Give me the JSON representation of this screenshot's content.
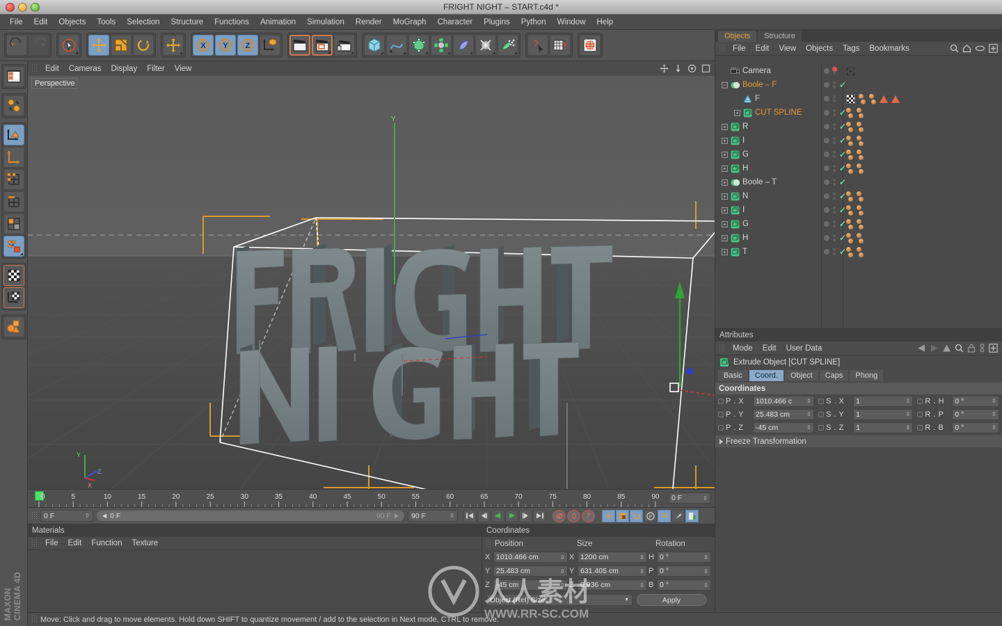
{
  "window": {
    "title": "FRIGHT NIGHT – START.c4d *"
  },
  "menubar": {
    "items": [
      "File",
      "Edit",
      "Objects",
      "Tools",
      "Selection",
      "Structure",
      "Functions",
      "Animation",
      "Simulation",
      "Render",
      "MoGraph",
      "Character",
      "Plugins",
      "Python",
      "Window",
      "Help"
    ]
  },
  "toolbar": {
    "groups": [
      {
        "buttons": [
          {
            "name": "undo-button",
            "icon": "undo",
            "state": "normal"
          },
          {
            "name": "redo-button",
            "icon": "redo",
            "state": "disabled"
          }
        ]
      },
      {
        "buttons": [
          {
            "name": "live-selection-button",
            "icon": "live-selection",
            "state": "normal",
            "corner": true
          }
        ]
      },
      {
        "buttons": [
          {
            "name": "move-tool-button",
            "icon": "move",
            "state": "selected"
          },
          {
            "name": "scale-tool-button",
            "icon": "scale",
            "state": "normal"
          },
          {
            "name": "rotate-tool-button",
            "icon": "rotate",
            "state": "normal"
          }
        ]
      },
      {
        "buttons": [
          {
            "name": "move-alt-button",
            "icon": "move",
            "state": "normal",
            "corner": true
          }
        ]
      },
      {
        "buttons": [
          {
            "name": "axis-x-button",
            "icon": "axis-x",
            "state": "selected"
          },
          {
            "name": "axis-y-button",
            "icon": "axis-y",
            "state": "selected"
          },
          {
            "name": "axis-z-button",
            "icon": "axis-z",
            "state": "selected"
          },
          {
            "name": "world-object-axis-button",
            "icon": "world-axis",
            "state": "normal"
          }
        ]
      },
      {
        "buttons": [
          {
            "name": "render-view-button",
            "icon": "render-view",
            "state": "highlight"
          },
          {
            "name": "render-region-button",
            "icon": "render-region",
            "state": "highlight-small",
            "corner": true
          },
          {
            "name": "render-settings-button",
            "icon": "render-settings",
            "state": "normal",
            "corner": true
          }
        ]
      },
      {
        "buttons": [
          {
            "name": "primitive-cube-button",
            "icon": "cube",
            "state": "normal",
            "corner": true
          },
          {
            "name": "spline-pen-button",
            "icon": "spline",
            "state": "normal",
            "corner": true
          },
          {
            "name": "generator-nurbs-button",
            "icon": "nurbs",
            "state": "normal",
            "corner": true
          },
          {
            "name": "modeling-object-button",
            "icon": "deformer-green",
            "state": "normal",
            "corner": true
          },
          {
            "name": "deformer-button",
            "icon": "bend",
            "state": "normal",
            "corner": true
          },
          {
            "name": "environment-button",
            "icon": "light",
            "state": "normal",
            "corner": true
          },
          {
            "name": "camera-button",
            "icon": "particles",
            "state": "normal",
            "corner": true
          }
        ]
      },
      {
        "buttons": [
          {
            "name": "help-cursor-button",
            "icon": "help-cursor",
            "state": "normal"
          },
          {
            "name": "help-table-button",
            "icon": "help-table",
            "state": "normal"
          }
        ]
      },
      {
        "buttons": [
          {
            "name": "content-browser-button",
            "icon": "globe",
            "state": "normal"
          }
        ]
      }
    ]
  },
  "left_rail": {
    "groups": [
      {
        "buttons": [
          {
            "name": "layout-button",
            "icon": "layout",
            "state": "normal"
          }
        ]
      },
      {
        "buttons": [
          {
            "name": "undo-view-button",
            "icon": "view-nav",
            "state": "normal"
          }
        ]
      },
      {
        "buttons": [
          {
            "name": "object-mode-button",
            "icon": "object-axis",
            "state": "selected"
          },
          {
            "name": "axis-mode-button",
            "icon": "axis",
            "state": "normal"
          },
          {
            "name": "point-mode-button",
            "icon": "points",
            "state": "normal"
          },
          {
            "name": "edge-mode-button",
            "icon": "edges",
            "state": "normal"
          },
          {
            "name": "polygon-mode-button",
            "icon": "polygons",
            "state": "normal"
          },
          {
            "name": "model-mode-button",
            "icon": "model",
            "state": "selected",
            "corner": true
          }
        ]
      },
      {
        "buttons": [
          {
            "name": "texture-mode-button",
            "icon": "texture",
            "state": "highlight"
          },
          {
            "name": "texture-axis-button",
            "icon": "texture-axis",
            "state": "highlight"
          }
        ]
      },
      {
        "buttons": [
          {
            "name": "enable-axis-button",
            "icon": "maxon-objects",
            "state": "normal"
          }
        ]
      }
    ],
    "brand": "MAXON\nCINEMA 4D",
    "brand_line1": "MAXON",
    "brand_line2": "CINEMA 4D"
  },
  "viewport": {
    "menu": [
      "Edit",
      "Cameras",
      "Display",
      "Filter",
      "View"
    ],
    "label": "Perspective",
    "scene_text_line1": "FRIGHT",
    "scene_text_line2": "NIGHT",
    "icons": [
      "move-view-icon",
      "scale-view-icon",
      "rotate-view-icon",
      "maximize-view-icon"
    ],
    "axis_labels": {
      "x": "X",
      "y": "Y",
      "z": "Z"
    }
  },
  "timeline": {
    "ticks": [
      0,
      5,
      10,
      15,
      20,
      25,
      30,
      35,
      40,
      45,
      50,
      55,
      60,
      65,
      70,
      75,
      80,
      85,
      90
    ],
    "current_frame_field": "0 F",
    "start_field": "0 F",
    "scrub_value": "0 F",
    "end_preview": "90 F",
    "end_field": "90 F",
    "transport": [
      "go-to-start",
      "step-back",
      "play-back",
      "play-forward",
      "step-forward",
      "go-to-end"
    ],
    "record_buttons": [
      "record-icon",
      "autokey-icon",
      "keyframe-selection-icon"
    ],
    "key_mode_buttons": [
      "position-key-icon",
      "scale-key-icon",
      "rotation-key-icon",
      "param-key-icon",
      "pla-key-icon",
      "point-level-icon",
      "autokey-toggle-icon"
    ]
  },
  "materials": {
    "title": "Materials",
    "menu": [
      "File",
      "Edit",
      "Function",
      "Texture"
    ]
  },
  "bottom_coordinates": {
    "title": "Coordinates",
    "columns": [
      "Position",
      "Size",
      "Rotation"
    ],
    "rows": [
      {
        "axis": "X",
        "position": "1010.466 cm",
        "size_axis": "X",
        "size": "1200 cm",
        "rot_axis": "H",
        "rotation": "0 °"
      },
      {
        "axis": "Y",
        "position": "25.483 cm",
        "size_axis": "Y",
        "size": "631.405 cm",
        "rot_axis": "P",
        "rotation": "0 °"
      },
      {
        "axis": "Z",
        "position": "-45 cm",
        "size_axis": "Z",
        "size": "0.936 cm",
        "rot_axis": "B",
        "rotation": "0 °"
      }
    ],
    "mode_select": "Object (Rel) Size",
    "apply_label": "Apply"
  },
  "statusbar": {
    "text": "Move: Click and drag to move elements. Hold down SHIFT to quantize movement / add to the selection in Next mode, CTRL to remove."
  },
  "objects_panel": {
    "tabs": [
      {
        "label": "Objects",
        "active": true
      },
      {
        "label": "Structure",
        "active": false
      }
    ],
    "menu": [
      "File",
      "Edit",
      "View",
      "Objects",
      "Tags",
      "Bookmarks"
    ],
    "right_icons": [
      "search-icon",
      "home-icon",
      "eye-icon",
      "plus-icon"
    ],
    "items": [
      {
        "name": "Camera",
        "indent": 0,
        "color": "white",
        "icon": "camera",
        "expander": "none",
        "dot_red": true,
        "check": false,
        "tags": [
          "target-tag"
        ]
      },
      {
        "name": "Boole – F",
        "indent": 0,
        "color": "orange",
        "icon": "boole",
        "expander": "minus",
        "check": true,
        "tags": []
      },
      {
        "name": "F",
        "indent": 1,
        "color": "white",
        "icon": "spline-cone",
        "expander": "none",
        "check": false,
        "tags": [
          "checker-texture",
          "material-dot",
          "material-dot",
          "triangle-red",
          "triangle-red"
        ]
      },
      {
        "name": "CUT SPLINE",
        "indent": 1,
        "color": "orange",
        "icon": "extrude",
        "expander": "plus",
        "check": true,
        "tags": [
          "material-dot",
          "material-dot"
        ]
      },
      {
        "name": "R",
        "indent": 0,
        "color": "white",
        "icon": "extrude",
        "expander": "plus",
        "check": true,
        "tags": [
          "material-dot",
          "material-dot"
        ]
      },
      {
        "name": "I",
        "indent": 0,
        "color": "white",
        "icon": "extrude",
        "expander": "plus",
        "check": true,
        "tags": [
          "material-dot",
          "material-dot"
        ]
      },
      {
        "name": "G",
        "indent": 0,
        "color": "white",
        "icon": "extrude",
        "expander": "plus",
        "check": true,
        "tags": [
          "material-dot",
          "material-dot"
        ]
      },
      {
        "name": "H",
        "indent": 0,
        "color": "white",
        "icon": "extrude",
        "expander": "plus",
        "check": true,
        "tags": [
          "material-dot",
          "material-dot"
        ]
      },
      {
        "name": "Boole – T",
        "indent": 0,
        "color": "white",
        "icon": "boole",
        "expander": "plus",
        "check": true,
        "tags": []
      },
      {
        "name": "N",
        "indent": 0,
        "color": "white",
        "icon": "extrude",
        "expander": "plus",
        "check": true,
        "tags": [
          "material-dot",
          "material-dot"
        ]
      },
      {
        "name": "I",
        "indent": 0,
        "color": "white",
        "icon": "extrude",
        "expander": "plus",
        "check": true,
        "tags": [
          "material-dot",
          "material-dot"
        ]
      },
      {
        "name": "G",
        "indent": 0,
        "color": "white",
        "icon": "extrude",
        "expander": "plus",
        "check": true,
        "tags": [
          "material-dot",
          "material-dot"
        ]
      },
      {
        "name": "H",
        "indent": 0,
        "color": "white",
        "icon": "extrude",
        "expander": "plus",
        "check": true,
        "tags": [
          "material-dot",
          "material-dot"
        ]
      },
      {
        "name": "T",
        "indent": 0,
        "color": "white",
        "icon": "extrude",
        "expander": "plus",
        "check": true,
        "tags": [
          "material-dot",
          "material-dot"
        ]
      }
    ]
  },
  "attributes_panel": {
    "title": "Attributes",
    "menu": [
      "Mode",
      "Edit",
      "User Data"
    ],
    "right_icons": [
      "back-arrow-icon",
      "forward-arrow-icon",
      "up-arrow-icon",
      "search-icon",
      "lock-icon",
      "link-icon",
      "plus-icon"
    ],
    "object_label": "Extrude Object [CUT SPLINE]",
    "tabs": [
      {
        "label": "Basic",
        "active": false
      },
      {
        "label": "Coord.",
        "active": true
      },
      {
        "label": "Object",
        "active": false
      },
      {
        "label": "Caps",
        "active": false
      },
      {
        "label": "Phong",
        "active": false
      }
    ],
    "section_title": "Coordinates",
    "rows": [
      {
        "pos_label": "P . X",
        "pos_value": "1010.466 c",
        "scale_label": "S . X",
        "scale_value": "1",
        "rot_label": "R . H",
        "rot_value": "0 °"
      },
      {
        "pos_label": "P . Y",
        "pos_value": "25.483 cm",
        "scale_label": "S . Y",
        "scale_value": "1",
        "rot_label": "R . P",
        "rot_value": "0 °"
      },
      {
        "pos_label": "P . Z",
        "pos_value": "-45 cm",
        "scale_label": "S . Z",
        "scale_value": "1",
        "rot_label": "R . B",
        "rot_value": "0 °"
      }
    ],
    "freeze_label": "Freeze Transformation"
  },
  "colors": {
    "accent_orange": "#e79a36",
    "accent_blue": "#7c9fc4",
    "check_green": "#6fd49a",
    "panel_bg": "#4a4a4a",
    "toolbar_bg": "#545454",
    "tag_orange": "#b3732f",
    "red_triangle": "#e06a4a"
  },
  "watermark": {
    "line1": "人人素材",
    "line2": "WWW.RR-SC.COM"
  }
}
